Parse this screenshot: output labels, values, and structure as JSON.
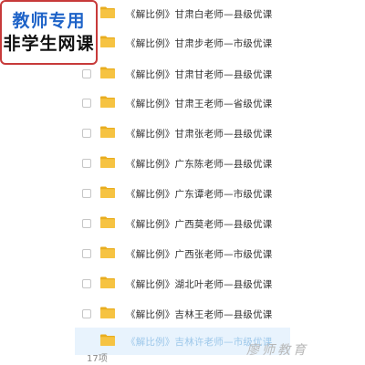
{
  "badge": {
    "line1": "教师专用",
    "line2": "非学生网课"
  },
  "files": [
    {
      "name": "《解比例》甘肃白老师—县级优课",
      "checkbox": false,
      "icon": "folder-icon"
    },
    {
      "name": "《解比例》甘肃步老师—市级优课",
      "checkbox": false,
      "icon": "folder-icon"
    },
    {
      "name": "《解比例》甘肃甘老师—县级优课",
      "checkbox": true,
      "icon": "folder-icon"
    },
    {
      "name": "《解比例》甘肃王老师—省级优课",
      "checkbox": true,
      "icon": "folder-icon"
    },
    {
      "name": "《解比例》甘肃张老师—县级优课",
      "checkbox": true,
      "icon": "folder-icon"
    },
    {
      "name": "《解比例》广东陈老师—县级优课",
      "checkbox": true,
      "icon": "folder-icon"
    },
    {
      "name": "《解比例》广东谭老师—市级优课",
      "checkbox": true,
      "icon": "folder-icon"
    },
    {
      "name": "《解比例》广西莫老师—县级优课",
      "checkbox": true,
      "icon": "folder-icon"
    },
    {
      "name": "《解比例》广西张老师—市级优课",
      "checkbox": true,
      "icon": "folder-icon"
    },
    {
      "name": "《解比例》湖北叶老师—县级优课",
      "checkbox": true,
      "icon": "folder-icon"
    },
    {
      "name": "《解比例》吉林王老师—县级优课",
      "checkbox": true,
      "icon": "folder-icon"
    },
    {
      "name": "《解比例》吉林许老师—市级优课",
      "checkbox": false,
      "icon": "folder-icon",
      "highlighted": true
    }
  ],
  "footer": {
    "item_count": "17项",
    "watermark": "廖师教育"
  },
  "colors": {
    "folder": "#f6c342",
    "folder_dark": "#e9ad1f",
    "badge_border": "#c73a3a",
    "badge_line1": "#1e63c8",
    "highlight_row": "#e8f3fd"
  }
}
